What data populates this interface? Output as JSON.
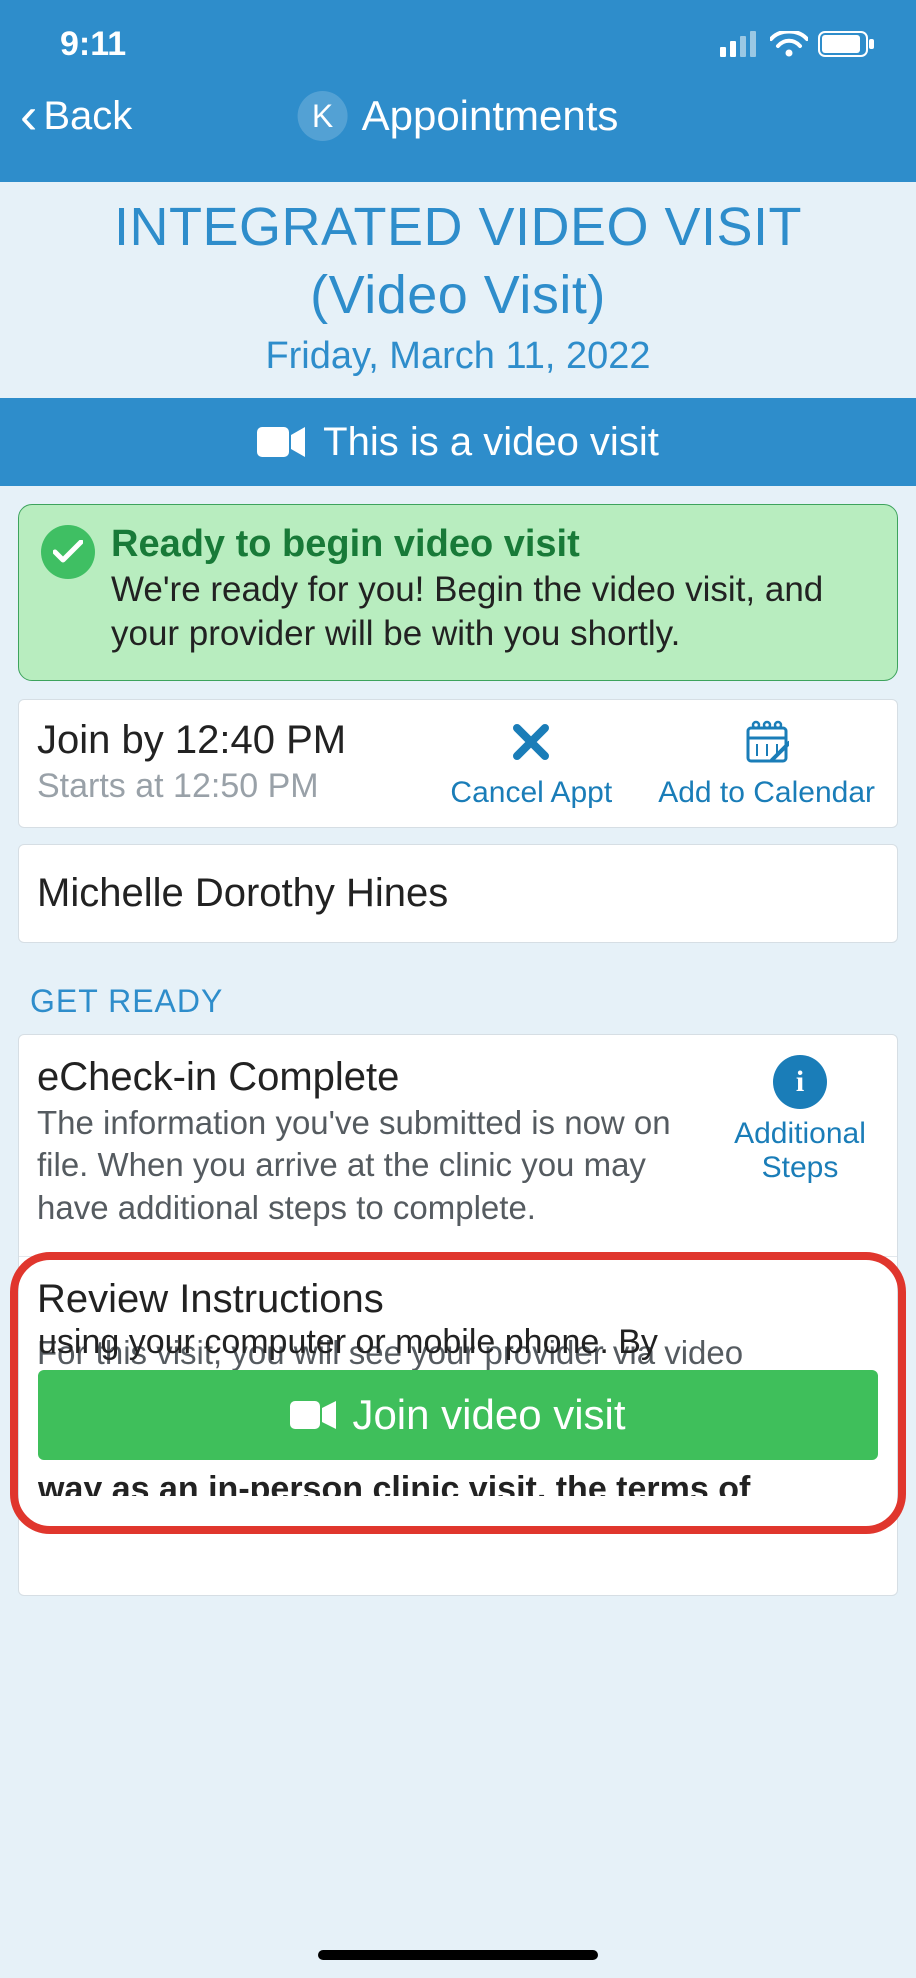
{
  "status": {
    "time": "9:11"
  },
  "nav": {
    "back": "Back",
    "badge": "K",
    "title": "Appointments"
  },
  "header": {
    "title_line1": "INTEGRATED VIDEO VISIT",
    "title_line2": "(Video Visit)",
    "date": "Friday, March 11, 2022"
  },
  "banner": {
    "text": "This is a video visit"
  },
  "ready": {
    "title": "Ready to begin video visit",
    "body": "We're ready for you! Begin the video visit, and your provider will be with you shortly."
  },
  "join": {
    "by": "Join by 12:40 PM",
    "starts": "Starts at 12:50 PM",
    "cancel": "Cancel Appt",
    "calendar": "Add to Calendar"
  },
  "patient": {
    "name": "Michelle Dorothy Hines"
  },
  "section": {
    "getready": "GET READY"
  },
  "echeck": {
    "title": "eCheck-in Complete",
    "body": "The information you've submitted is now on file. When you arrive at the clinic you may have additional steps to complete.",
    "side": "Additional Steps"
  },
  "review": {
    "title": "Review Instructions",
    "body_visible1": "For this visit, you will see your provider via video",
    "body_visible2": "using your computer or mobile phone.  By",
    "body_visible3": "way as an in-person clinic visit, the terms of"
  },
  "joinbtn": {
    "label": "Join video visit"
  }
}
